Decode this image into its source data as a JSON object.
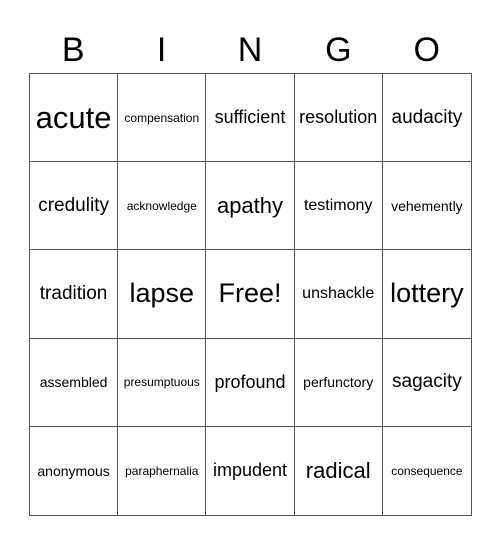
{
  "header": [
    "B",
    "I",
    "N",
    "G",
    "O"
  ],
  "cells": [
    [
      "acute",
      "compensation",
      "sufficient",
      "resolution",
      "audacity"
    ],
    [
      "credulity",
      "acknowledge",
      "apathy",
      "testimony",
      "vehemently"
    ],
    [
      "tradition",
      "lapse",
      "Free!",
      "unshackle",
      "lottery"
    ],
    [
      "assembled",
      "presumptuous",
      "profound",
      "perfunctory",
      "sagacity"
    ],
    [
      "anonymous",
      "paraphernalia",
      "impudent",
      "radical",
      "consequence"
    ]
  ]
}
